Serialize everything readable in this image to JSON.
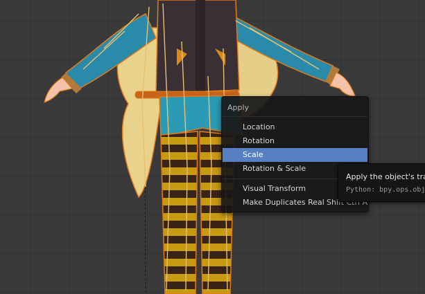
{
  "menu": {
    "title": "Apply",
    "items": [
      {
        "label": "Location",
        "shortcut": ""
      },
      {
        "label": "Rotation",
        "shortcut": ""
      },
      {
        "label": "Scale",
        "shortcut": ""
      },
      {
        "label": "Rotation & Scale",
        "shortcut": ""
      },
      {
        "label": "Visual Transform",
        "shortcut": ""
      },
      {
        "label": "Make Duplicates Real",
        "shortcut": "Shift Ctrl A"
      }
    ],
    "active_item": "Scale",
    "accent_color": "#5680c2"
  },
  "tooltip": {
    "text": "Apply the object's transformation to its data",
    "python": "Python: bpy.ops.object.transform_apply(scale=True)"
  }
}
